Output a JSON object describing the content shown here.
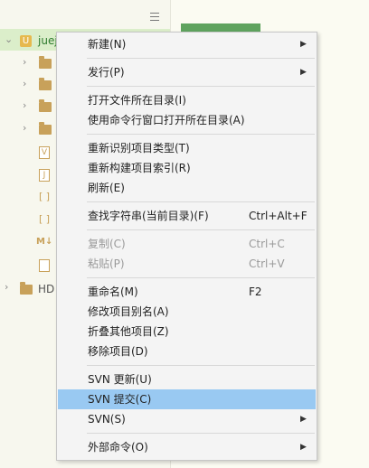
{
  "tree": {
    "project_label": "juej",
    "project_icon_glyph": "U",
    "hd_label": "HD",
    "file_glyphs": [
      "V",
      "J",
      "[ ]",
      "[ ]",
      "M↓"
    ]
  },
  "menu": {
    "items": [
      {
        "label": "新建(N)",
        "submenu": true
      },
      {
        "label": "发行(P)",
        "submenu": true
      },
      {
        "label": "打开文件所在目录(I)"
      },
      {
        "label": "使用命令行窗口打开所在目录(A)"
      },
      {
        "label": "重新识别项目类型(T)"
      },
      {
        "label": "重新构建项目索引(R)"
      },
      {
        "label": "刷新(E)"
      },
      {
        "label": "查找字符串(当前目录)(F)",
        "shortcut": "Ctrl+Alt+F"
      },
      {
        "label": "复制(C)",
        "shortcut": "Ctrl+C",
        "disabled": true
      },
      {
        "label": "粘贴(P)",
        "shortcut": "Ctrl+V",
        "disabled": true
      },
      {
        "label": "重命名(M)",
        "shortcut": "F2"
      },
      {
        "label": "修改项目别名(A)"
      },
      {
        "label": "折叠其他项目(Z)"
      },
      {
        "label": "移除项目(D)"
      },
      {
        "label": "SVN 更新(U)"
      },
      {
        "label": "SVN 提交(C)",
        "highlighted": true
      },
      {
        "label": "SVN(S)",
        "submenu": true
      },
      {
        "label": "外部命令(O)",
        "submenu": true
      }
    ],
    "arrow_glyph": "▶"
  },
  "colors": {
    "highlight": "#99c9f2",
    "selected_row": "#dbeeca",
    "folder": "#c8a15a",
    "accent_green": "#5fa35f"
  }
}
